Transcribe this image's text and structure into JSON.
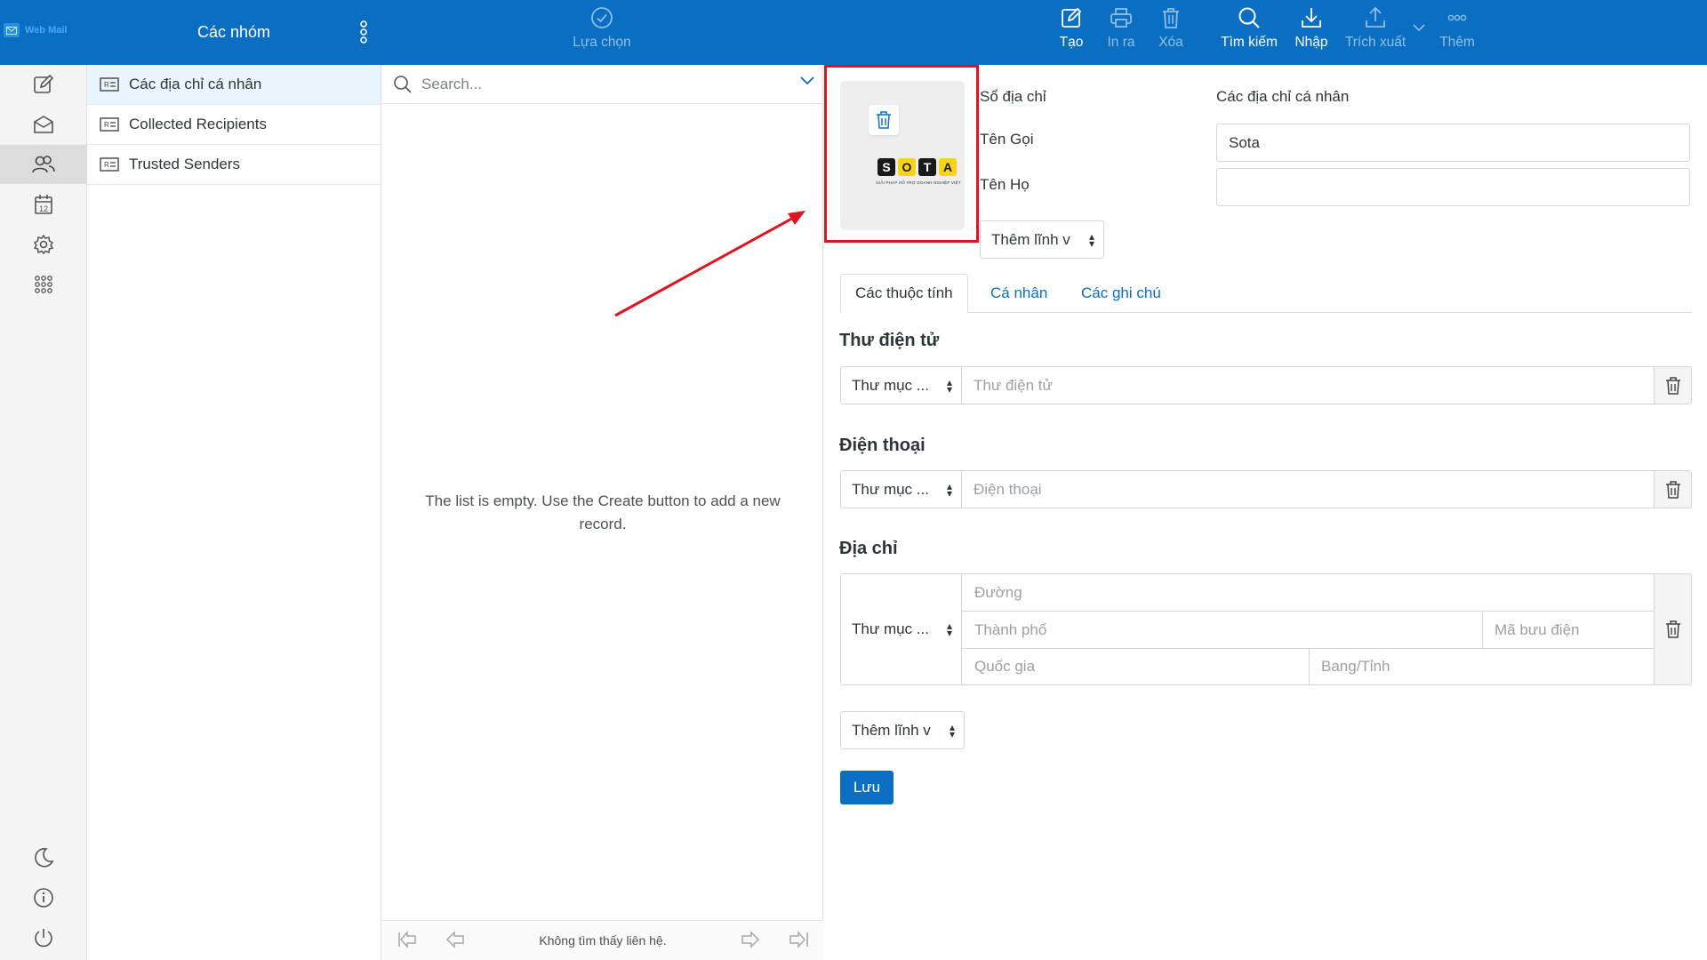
{
  "brand": {
    "logo_text": "Web Mail"
  },
  "groups_header": {
    "title": "Các nhóm"
  },
  "toolbar": {
    "select_label": "Lựa chọn",
    "create_label": "Tạo",
    "print_label": "In ra",
    "delete_label": "Xóa",
    "search_label": "Tìm kiếm",
    "import_label": "Nhập",
    "export_label": "Trích xuất",
    "more_label": "Thêm"
  },
  "rail": {
    "items": [
      "compose-icon",
      "mail-icon",
      "contacts-icon",
      "calendar-icon",
      "settings-icon",
      "apps-icon"
    ],
    "bottom": [
      "dark-mode-icon",
      "about-icon",
      "logout-icon"
    ],
    "calendar_day": "12",
    "active": "contacts-icon"
  },
  "groups": {
    "items": [
      {
        "label": "Các địa chỉ cá nhân",
        "selected": true
      },
      {
        "label": "Collected Recipients",
        "selected": false
      },
      {
        "label": "Trusted Senders",
        "selected": false
      }
    ]
  },
  "contact_list": {
    "search_placeholder": "Search...",
    "empty_message": "The list is empty. Use the Create button to add a new record.",
    "footer_text": "Không tìm thấy liên hệ."
  },
  "form": {
    "photo": {
      "logo_letters": [
        "S",
        "O",
        "T",
        "A"
      ],
      "tagline": "GIẢI PHÁP HỖ TRỢ DOANH NGHIỆP VIỆT"
    },
    "address_book_label": "Sổ địa chỉ",
    "address_book_value": "Các địa chỉ cá nhân",
    "first_name_label": "Tên Gọi",
    "first_name_value": "Sota",
    "last_name_label": "Tên Họ",
    "last_name_value": "",
    "add_field_top": "Thêm lĩnh v",
    "tabs": [
      {
        "label": "Các thuộc tính",
        "active": true
      },
      {
        "label": "Cá nhân",
        "active": false
      },
      {
        "label": "Các ghi chú",
        "active": false
      }
    ],
    "email": {
      "title": "Thư điện tử",
      "type": "Thư mục ...",
      "placeholder": "Thư điện tử"
    },
    "phone": {
      "title": "Điện thoại",
      "type": "Thư mục ...",
      "placeholder": "Điện thoại"
    },
    "address": {
      "title": "Địa chỉ",
      "type": "Thư mục ...",
      "street_placeholder": "Đường",
      "city_placeholder": "Thành phố",
      "zip_placeholder": "Mã bưu điện",
      "country_placeholder": "Quốc gia",
      "region_placeholder": "Bang/Tỉnh"
    },
    "add_field_bottom": "Thêm lĩnh v",
    "save_label": "Lưu"
  },
  "colors": {
    "header": "#0a6fc2",
    "accent": "#0a6fc2",
    "highlight": "#e0141e"
  }
}
